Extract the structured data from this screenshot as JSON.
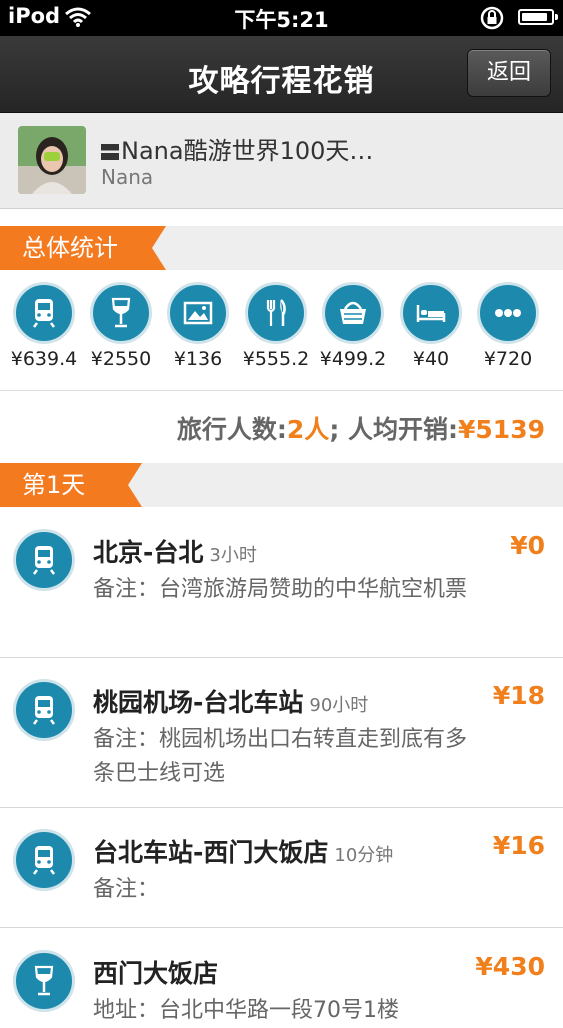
{
  "status_bar": {
    "carrier": "iPod",
    "time": "下午5:21",
    "battery_level": 0.9
  },
  "nav": {
    "title": "攻略行程花销",
    "back_label": "返回"
  },
  "user": {
    "trip_title": "Nana酷游世界100天…",
    "name": "Nana"
  },
  "overall": {
    "label": "总体统计",
    "categories": [
      {
        "icon": "train-icon",
        "value": "¥639.4"
      },
      {
        "icon": "wine-glass-icon",
        "value": "¥2550"
      },
      {
        "icon": "picture-icon",
        "value": "¥136"
      },
      {
        "icon": "fork-knife-icon",
        "value": "¥555.2"
      },
      {
        "icon": "basket-icon",
        "value": "¥499.2"
      },
      {
        "icon": "bed-icon",
        "value": "¥40"
      },
      {
        "icon": "more-icon",
        "value": "¥720"
      }
    ],
    "summary": {
      "people_label": "旅行人数:",
      "people_value": "2人",
      "sep": "; 人均开销:",
      "avg_value": "¥5139"
    }
  },
  "day1": {
    "label": "第1天",
    "entries": [
      {
        "icon": "train-icon",
        "title": "北京-台北",
        "duration": "3小时",
        "price": "¥0",
        "note": "备注：台湾旅游局赞助的中华航空机票"
      },
      {
        "icon": "train-icon",
        "title": "桃园机场-台北车站",
        "duration": "90小时",
        "price": "¥18",
        "note": "备注：桃园机场出口右转直走到底有多条巴士线可选"
      },
      {
        "icon": "train-icon",
        "title": "台北车站-西门大饭店",
        "duration": "10分钟",
        "price": "¥16",
        "note": "备注："
      },
      {
        "icon": "wine-glass-icon",
        "title": "西门大饭店",
        "duration": "",
        "price": "¥430",
        "note": "地址：台北中华路一段70号1楼"
      }
    ]
  },
  "colors": {
    "accent": "#f47a20",
    "icon_blue": "#1d89ad",
    "price": "#f07f1c"
  }
}
